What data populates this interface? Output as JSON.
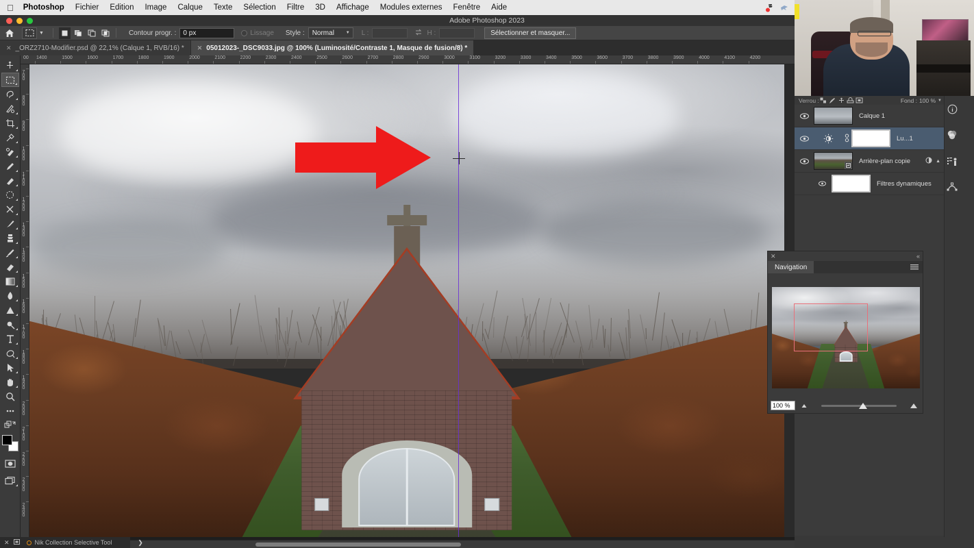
{
  "macbar": {
    "apple": "",
    "app_name": "Photoshop",
    "menus": [
      "Fichier",
      "Edition",
      "Image",
      "Calque",
      "Texte",
      "Sélection",
      "Filtre",
      "3D",
      "Affichage",
      "Modules externes",
      "Fenêtre",
      "Aide"
    ],
    "status_icons": [
      "creative-cloud-red-icon",
      "vpn-bird-icon",
      "creative-cloud-icon",
      "screen-record-icon",
      "display-transfer-icon",
      "clipboard-icon",
      "time-machine-icon",
      "spotlight-search-icon",
      "stage-manager-icon",
      "screen-mirroring-icon",
      "volume-icon",
      "control-center-icon",
      "wifi-icon",
      "battery-icon"
    ]
  },
  "window": {
    "title": "Adobe Photoshop 2023"
  },
  "options_bar": {
    "home_label": "home-icon",
    "tool_icon": "rectangular-marquee-icon",
    "selection_modes": [
      "new-selection",
      "add-to-selection",
      "subtract-from-selection",
      "intersect-selection"
    ],
    "feather_label": "Contour progr. :",
    "feather_value": "0 px",
    "antialias_label": "Lissage",
    "style_label": "Style :",
    "style_value": "Normal",
    "width_label": "L :",
    "width_value": "",
    "swap_icon": "swap-dimensions-icon",
    "height_label": "H :",
    "height_value": "",
    "select_and_mask": "Sélectionner et masquer..."
  },
  "tabs": [
    {
      "title": "_ORZ2710-Modifier.psd @ 22,1% (Calque 1, RVB/16) *",
      "active": false
    },
    {
      "title": "05012023-_DSC9033.jpg @ 100% (Luminosité/Contraste 1, Masque de fusion/8) *",
      "active": true
    }
  ],
  "toolbar": {
    "tools": [
      {
        "name": "move-tool",
        "glyph": "move"
      },
      {
        "name": "rectangular-marquee-tool",
        "glyph": "marquee",
        "selected": true
      },
      {
        "name": "lasso-tool",
        "glyph": "lasso"
      },
      {
        "name": "object-selection-tool",
        "glyph": "quickselect"
      },
      {
        "name": "crop-tool",
        "glyph": "crop"
      },
      {
        "name": "eyedropper-tool",
        "glyph": "eyedropper"
      },
      {
        "name": "spot-healing-brush-tool",
        "glyph": "healing"
      },
      {
        "name": "brush-tool",
        "glyph": "brush2"
      },
      {
        "name": "patch-tool",
        "glyph": "patch"
      },
      {
        "name": "scissors-tool",
        "glyph": "scissors"
      },
      {
        "name": "paintbrush-tool",
        "glyph": "paintbrush"
      },
      {
        "name": "clone-stamp-tool",
        "glyph": "stamp"
      },
      {
        "name": "history-brush-tool",
        "glyph": "historybrush"
      },
      {
        "name": "eraser-tool",
        "glyph": "eraser"
      },
      {
        "name": "gradient-tool",
        "glyph": "gradient"
      },
      {
        "name": "blur-tool",
        "glyph": "blur"
      },
      {
        "name": "dodge-tool",
        "glyph": "dodge"
      },
      {
        "name": "pen-tool",
        "glyph": "pen"
      },
      {
        "name": "horizontal-type-tool",
        "glyph": "type"
      },
      {
        "name": "path-selection-tool",
        "glyph": "pathsel"
      },
      {
        "name": "direct-selection-tool",
        "glyph": "arrowsel"
      },
      {
        "name": "hand-tool",
        "glyph": "hand"
      },
      {
        "name": "zoom-tool",
        "glyph": "zoom"
      },
      {
        "name": "edit-toolbar",
        "glyph": "dots"
      },
      {
        "name": "default-colors",
        "glyph": "defaults"
      }
    ],
    "foreground_color": "#000000",
    "background_color": "#ffffff",
    "quick_mask": "quick-mask-icon",
    "screen_mode": "screen-mode-icon"
  },
  "rulers": {
    "unit_hint": "px",
    "h_start_label": "00",
    "h_ticks": [
      "1400",
      "1500",
      "1600",
      "1700",
      "1800",
      "1900",
      "2000",
      "2100",
      "2200",
      "2300",
      "2400",
      "2500",
      "2600",
      "2700",
      "2800",
      "2900",
      "3000",
      "3100",
      "3200",
      "3300",
      "3400",
      "3500",
      "3600",
      "3700",
      "3800",
      "3900",
      "4000",
      "4100",
      "4200"
    ],
    "v_ticks": [
      "700",
      "800",
      "900",
      "1000",
      "1100",
      "1200",
      "1300",
      "1400",
      "1500",
      "1600",
      "1700",
      "1800",
      "1900",
      "2000",
      "2100",
      "2200",
      "2300",
      "2400"
    ]
  },
  "canvas": {
    "image_description": "Brick chapel with cross at centre of a hedge-lined path under grey clouds",
    "annotation_arrow": {
      "name": "red-arrow-annotation",
      "color": "#ee1b1b"
    },
    "guide_color": "#6a2fd6",
    "cursor": "crosshair-cursor"
  },
  "layers_panel": {
    "lock_label": "Verrou :",
    "lock_icons": [
      "lock-transparent-pixels",
      "lock-image-pixels",
      "lock-position",
      "lock-nesting",
      "lock-all"
    ],
    "fill_label": "Fond :",
    "fill_value": "100 %",
    "layers": [
      {
        "name": "Calque 1",
        "visible": true,
        "selected": false,
        "thumb": "sky",
        "kind": "pixel"
      },
      {
        "name": "Lu...1",
        "visible": true,
        "selected": true,
        "thumb": "white-mask",
        "kind": "adjustment"
      },
      {
        "name": "Arrière-plan copie",
        "visible": true,
        "selected": false,
        "thumb": "scene",
        "kind": "smart-object"
      },
      {
        "name": "Filtres dynamiques",
        "visible": true,
        "selected": false,
        "thumb": "white-mask",
        "kind": "smart-filters"
      }
    ],
    "footer_icons": [
      "link-layers-icon",
      "layer-style-fx-icon",
      "add-layer-mask-icon",
      "new-adjustment-layer-icon",
      "new-group-icon",
      "new-layer-icon",
      "delete-layer-icon"
    ]
  },
  "right_strip": {
    "icons": [
      "info-panel-icon",
      "color-wheel-icon",
      "histogram-actions-icon",
      "paths-icon"
    ]
  },
  "navigation_panel": {
    "title": "Navigation",
    "close_icon": "close-icon",
    "collapse_icon": "collapse-panel-icon",
    "menu_icon": "panel-menu-icon",
    "zoom_value": "100 %",
    "view_box_color": "#e8707a",
    "zoom_out_icon": "zoom-out-icon",
    "zoom_in_icon": "zoom-in-icon"
  },
  "status_bar": {
    "close_icon": "close-icon",
    "restore_icon": "restore-icon",
    "plugin_name": "Nik Collection Selective Tool",
    "expand_arrow": "chevron-right-icon"
  }
}
